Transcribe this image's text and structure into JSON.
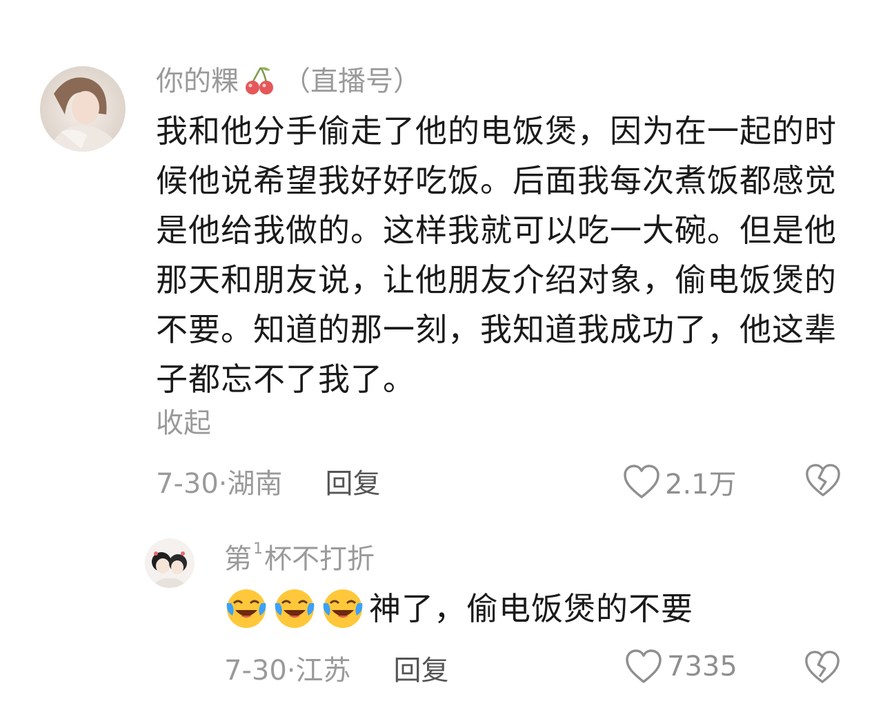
{
  "comments": [
    {
      "username": "你的粿",
      "username_icon": "cherry-icon",
      "tag": "（直播号）",
      "text": "我和他分手偷走了他的电饭煲，因为在一起的时候他说希望我好好吃饭。后面我每次煮饭都感觉是他给我做的。这样我就可以吃一大碗。但是他那天和朋友说，让他朋友介绍对象，偷电饭煲的不要。知道的那一刻，我知道我成功了，他这辈子都忘不了我了。",
      "collapse_label": "收起",
      "date_location": "7-30·湖南",
      "reply_label": "回复",
      "like_count": "2.1万"
    },
    {
      "username_prefix": "第",
      "username_sup": "1",
      "username_suffix": "杯不打折",
      "emoji": [
        "laugh-cry-emoji",
        "laugh-cry-emoji",
        "laugh-cry-emoji"
      ],
      "text": "神了，偷电饭煲的不要",
      "date_location": "7-30·江苏",
      "reply_label": "回复",
      "like_count": "7335"
    }
  ],
  "colors": {
    "text_primary": "#1a1a1a",
    "text_secondary": "#9a9a9a",
    "reply_button": "#555555",
    "background": "#ffffff"
  }
}
